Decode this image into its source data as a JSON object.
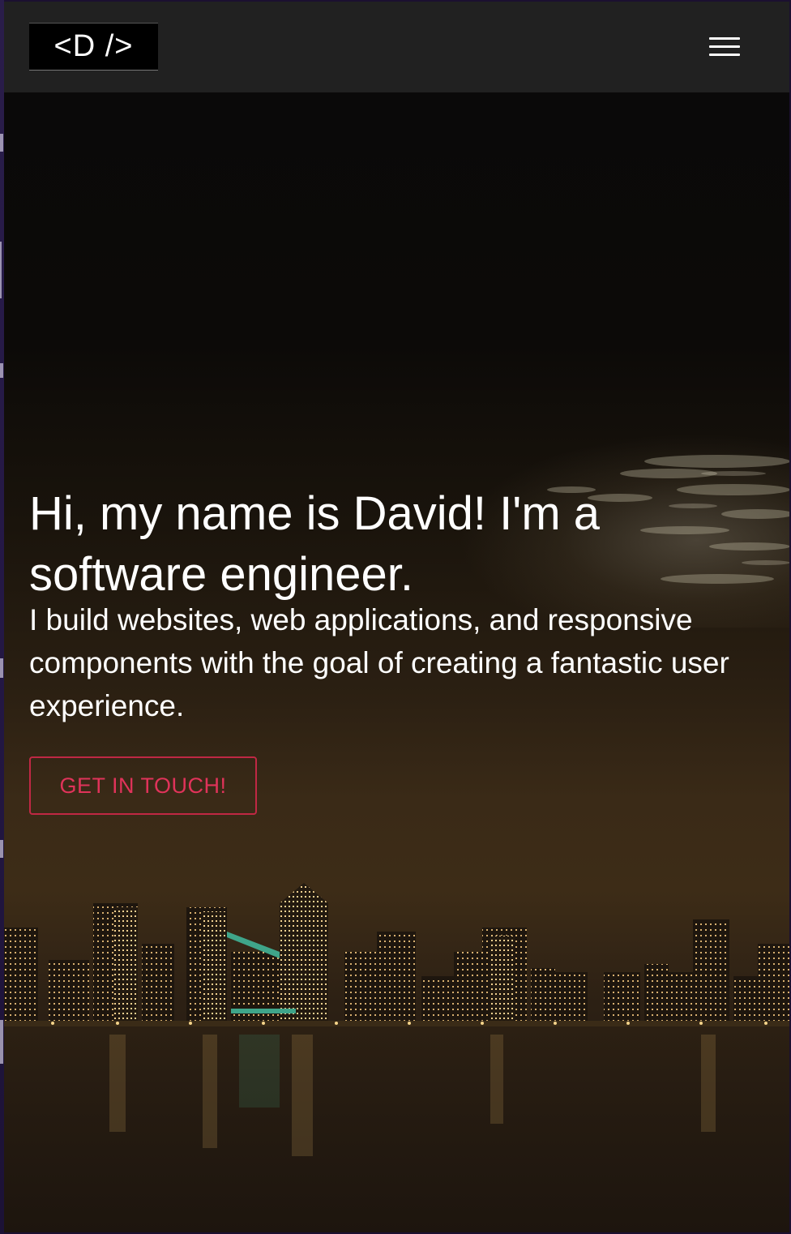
{
  "navbar": {
    "logo_text": "<D />",
    "menu_icon": "hamburger-menu-icon"
  },
  "hero": {
    "headline": "Hi, my name is David! I'm a software engineer.",
    "subtext": "I build websites, web applications, and responsive components with the goal of creating a fantastic user experience.",
    "cta_label": "GET IN TOUCH!",
    "background_image": "night city skyline over water"
  },
  "colors": {
    "navbar_bg": "#212121",
    "accent": "#e0335a",
    "text": "#ffffff"
  }
}
